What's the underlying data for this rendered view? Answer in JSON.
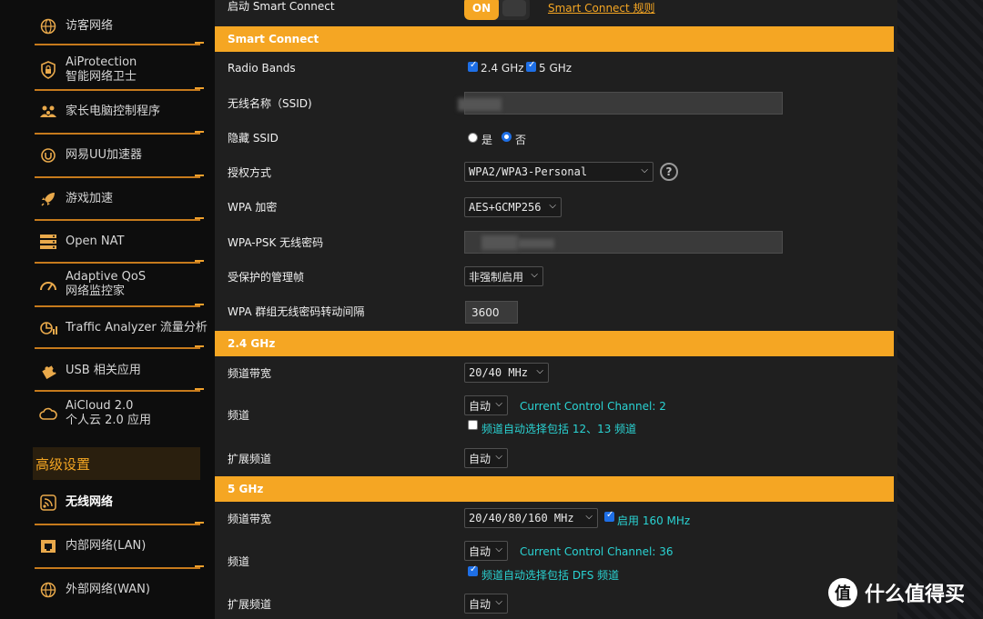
{
  "sidebar": {
    "items": [
      {
        "label": "访客网络",
        "icon": "globe-icon"
      },
      {
        "label": "AiProtection",
        "label2": "智能网络卫士",
        "icon": "shield-lock-icon"
      },
      {
        "label": "家长电脑控制程序",
        "icon": "family-icon"
      },
      {
        "label": "网易UU加速器",
        "icon": "uu-accelerator-icon"
      },
      {
        "label": "游戏加速",
        "icon": "rocket-icon"
      },
      {
        "label": "Open NAT",
        "icon": "server-icon"
      },
      {
        "label": "Adaptive QoS",
        "label2": "网络监控家",
        "icon": "speedometer-icon"
      },
      {
        "label": "Traffic Analyzer 流量分析",
        "icon": "traffic-analyzer-icon"
      },
      {
        "label": "USB 相关应用",
        "icon": "puzzle-icon"
      },
      {
        "label": "AiCloud 2.0",
        "label2": "个人云 2.0 应用",
        "icon": "cloud-icon"
      }
    ],
    "advanced_header": "高级设置",
    "advanced_items": [
      {
        "label": "无线网络",
        "icon": "wireless-icon",
        "active": true
      },
      {
        "label": "内部网络(LAN)",
        "icon": "lan-icon"
      },
      {
        "label": "外部网络(WAN)",
        "icon": "wan-globe-icon"
      }
    ]
  },
  "top": {
    "smart_connect_label": "启动 Smart Connect",
    "toggle_text": "ON",
    "rule_link": "Smart Connect 规则"
  },
  "smart_connect": {
    "section_title": "Smart Connect",
    "radio_bands_label": "Radio Bands",
    "band_24": "2.4 GHz",
    "band_5": "5 GHz",
    "ssid_label": "无线名称（SSID)",
    "hide_ssid_label": "隐藏 SSID",
    "hide_yes": "是",
    "hide_no": "否",
    "auth_label": "授权方式",
    "auth_value": "WPA2/WPA3-Personal",
    "encrypt_label": "WPA 加密",
    "encrypt_value": "AES+GCMP256",
    "psk_label": "WPA-PSK 无线密码",
    "pmf_label": "受保护的管理帧",
    "pmf_value": "非强制启用",
    "rekey_label": "WPA 群组无线密码转动间隔",
    "rekey_value": "3600"
  },
  "band24": {
    "section_title": "2.4 GHz",
    "bandwidth_label": "频道带宽",
    "bandwidth_value": "20/40 MHz",
    "channel_label": "频道",
    "channel_value": "自动",
    "current_channel": "Current Control Channel: 2",
    "auto_include": "频道自动选择包括 12、13 频道",
    "ext_label": "扩展频道",
    "ext_value": "自动"
  },
  "band5": {
    "section_title": "5 GHz",
    "bandwidth_label": "频道带宽",
    "bandwidth_value": "20/40/80/160 MHz",
    "enable_160": "启用 160 MHz",
    "channel_label": "频道",
    "channel_value": "自动",
    "current_channel": "Current Control Channel: 36",
    "auto_include": "频道自动选择包括 DFS 频道",
    "ext_label": "扩展频道",
    "ext_value": "自动"
  },
  "watermark": "什么值得买",
  "colors": {
    "accent": "#f5a623",
    "cyan": "#2ad3d3",
    "panel": "#1f1f1f"
  }
}
